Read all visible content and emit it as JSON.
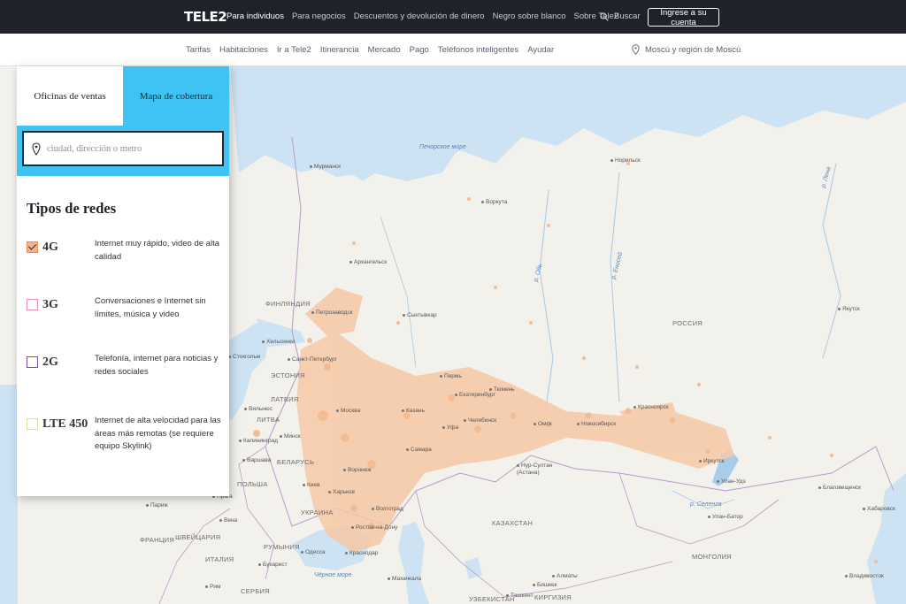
{
  "header": {
    "logo": "TELE2",
    "nav": [
      "Para individuos",
      "Para negocios",
      "Descuentos y devolución de dinero",
      "Negro sobre blanco",
      "Sobre Tele2"
    ],
    "search_label": "Buscar",
    "login_label": "Ingrese a su cuenta"
  },
  "subnav": {
    "items": [
      "Tarifas",
      "Habitaciones",
      "Ir a Tele2",
      "Itinerancia",
      "Mercado",
      "Pago",
      "Teléfonos inteligentes",
      "Ayudar"
    ],
    "region": "Moscú y región de Moscú"
  },
  "panel": {
    "tabs": [
      "Oficinas de ventas",
      "Mapa de cobertura"
    ],
    "search_placeholder": "ciudad, dirección o metro",
    "networks_title": "Tipos de redes",
    "networks": [
      {
        "label": "4G",
        "desc": "Internet muy rápido, video de alta calidad",
        "checked": true,
        "color": "#ee8a4f"
      },
      {
        "label": "3G",
        "desc": "Conversaciones e Internet sin límites, música y video",
        "checked": false,
        "color": "#e88cc1"
      },
      {
        "label": "2G",
        "desc": "Telefonía, internet para noticias y redes sociales",
        "checked": false,
        "color": "#7a4fa0"
      },
      {
        "label": "LTE 450",
        "desc": "Internet de alta velocidad para las áreas más remotas (se requiere equipo Skylink)",
        "checked": false,
        "color": "#e9d79a"
      }
    ]
  },
  "map": {
    "seas": [
      "Печорское море",
      "Чёрное море"
    ],
    "countries": [
      "ФИНЛЯНДИЯ",
      "РОССИЯ",
      "КАЗАХСТАН",
      "МОНГОЛИЯ",
      "УКРАИНА",
      "БЕЛАРУСЬ",
      "ПОЛЬША",
      "ФРАНЦИЯ",
      "ЭСТОНИЯ",
      "ЛАТВИЯ",
      "ЛИТВА",
      "РУМЫНИЯ",
      "ШВЕЙЦАРИЯ",
      "ИТАЛИЯ",
      "СЕРБИЯ",
      "УЗБЕКИСТАН",
      "КИРГИЗИЯ"
    ],
    "cities": [
      "Мурманск",
      "Воркута",
      "Норильск",
      "Архангельск",
      "Петрозаводск",
      "Сыктывкар",
      "Хельсинки",
      "Стокгольм",
      "Санкт-Петербург",
      "Пермь",
      "Екатеринбург",
      "Тюмень",
      "Москва",
      "Казань",
      "Уфа",
      "Челябинск",
      "Омск",
      "Новосибирск",
      "Красноярск",
      "Иркутск",
      "Улан-Удэ",
      "Калининград",
      "Минск",
      "Варшава",
      "Самара",
      "Воронеж",
      "Киев",
      "Харьков",
      "Волгоград",
      "Ростов-на-Дону",
      "Краснодар",
      "Париж",
      "Прага",
      "Вена",
      "Нур-Султан (Астана)",
      "Улан-Батор",
      "Благовещенск",
      "Хабаровск",
      "Якутск",
      "Рим",
      "Одесса",
      "Бухарест",
      "Махачкала",
      "Алматы",
      "Ташкент",
      "Владивосток",
      "Вильнюс",
      "Бишкек"
    ],
    "rivers": [
      "р. Лена",
      "р. Енисей",
      "р. Обь",
      "р. Селенга"
    ]
  }
}
